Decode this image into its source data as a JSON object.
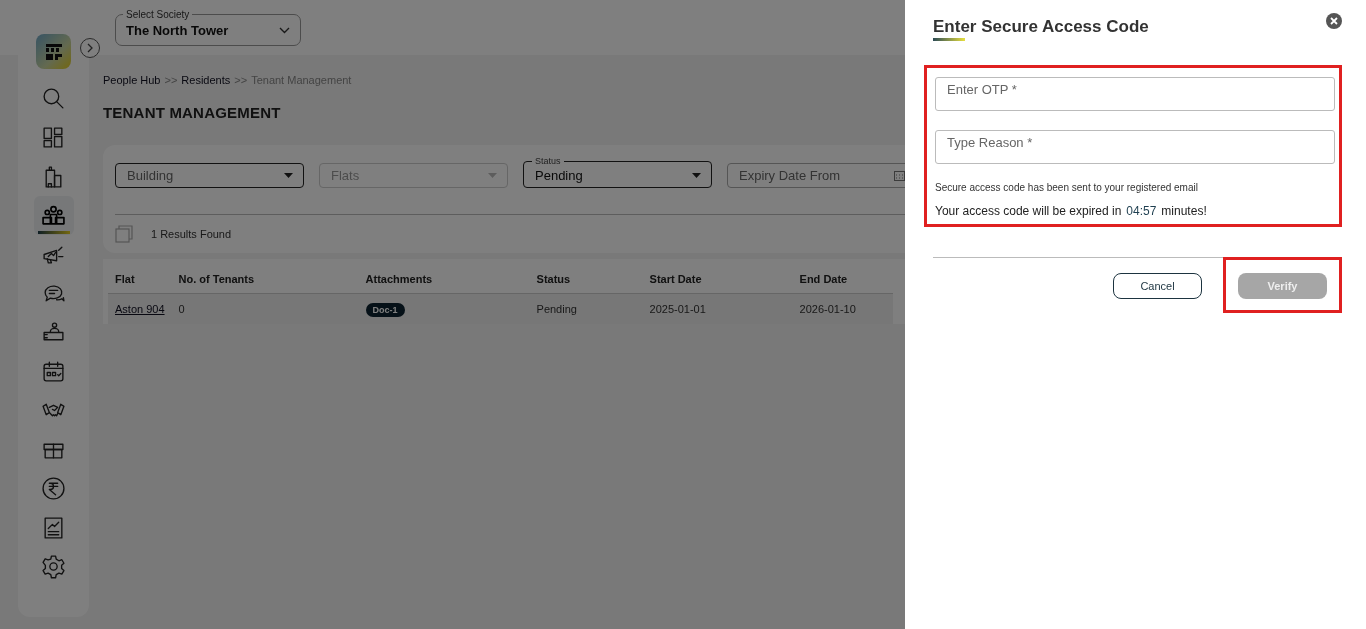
{
  "sidebar": {
    "items": [
      {
        "kind": "search",
        "selected": false
      },
      {
        "kind": "dashboard",
        "selected": false
      },
      {
        "kind": "building",
        "selected": false
      },
      {
        "kind": "people",
        "selected": true
      },
      {
        "kind": "megaphone",
        "selected": false
      },
      {
        "kind": "chat",
        "selected": false
      },
      {
        "kind": "reception",
        "selected": false
      },
      {
        "kind": "calendar",
        "selected": false
      },
      {
        "kind": "handshake",
        "selected": false
      },
      {
        "kind": "parcel",
        "selected": false
      },
      {
        "kind": "rupee",
        "selected": false
      },
      {
        "kind": "report",
        "selected": false
      },
      {
        "kind": "settings",
        "selected": false
      }
    ]
  },
  "society_select": {
    "label": "Select Society",
    "value": "The North Tower"
  },
  "breadcrumb": [
    {
      "kind": "link",
      "text": "People Hub"
    },
    {
      "kind": "separator",
      "text": ">>"
    },
    {
      "kind": "link",
      "text": "Residents"
    },
    {
      "kind": "separator",
      "text": ">>"
    },
    {
      "kind": "current",
      "text": "Tenant Management"
    }
  ],
  "page_title": "TENANT MANAGEMENT",
  "filters": [
    {
      "kind": "select",
      "placeholder": "Building",
      "disabled": false
    },
    {
      "kind": "select",
      "placeholder": "Flats",
      "disabled": true
    },
    {
      "kind": "select",
      "label": "Status",
      "value": "Pending",
      "disabled": false
    },
    {
      "kind": "date",
      "placeholder": "Expiry Date From",
      "disabled": false
    }
  ],
  "results_count": "1 Results Found",
  "table": {
    "columns": [
      "Flat",
      "No. of Tenants",
      "Attachments",
      "Status",
      "Start Date",
      "End Date"
    ],
    "rows": [
      {
        "cells": [
          {
            "kind": "link",
            "text": "Aston 904"
          },
          {
            "kind": "text",
            "text": "0"
          },
          {
            "kind": "badge",
            "text": "Doc-1"
          },
          {
            "kind": "text",
            "text": "Pending"
          },
          {
            "kind": "text",
            "text": "2025-01-01"
          },
          {
            "kind": "text",
            "text": "2026-01-10"
          }
        ]
      }
    ]
  },
  "drawer": {
    "open": true,
    "title": "Enter Secure Access Code",
    "form_highlighted": true,
    "fields": [
      {
        "placeholder": "Enter OTP *"
      },
      {
        "placeholder": "Type Reason *"
      }
    ],
    "info": "Secure access code has been sent to your registered email",
    "expiry_before": "Your access code will be expired in",
    "timer": "04:57",
    "expiry_after": "minutes!",
    "buttons": [
      {
        "kind": "cancel",
        "label": "Cancel",
        "disabled": false,
        "highlighted": false
      },
      {
        "kind": "verify",
        "label": "Verify",
        "disabled": true,
        "highlighted": true
      }
    ]
  }
}
